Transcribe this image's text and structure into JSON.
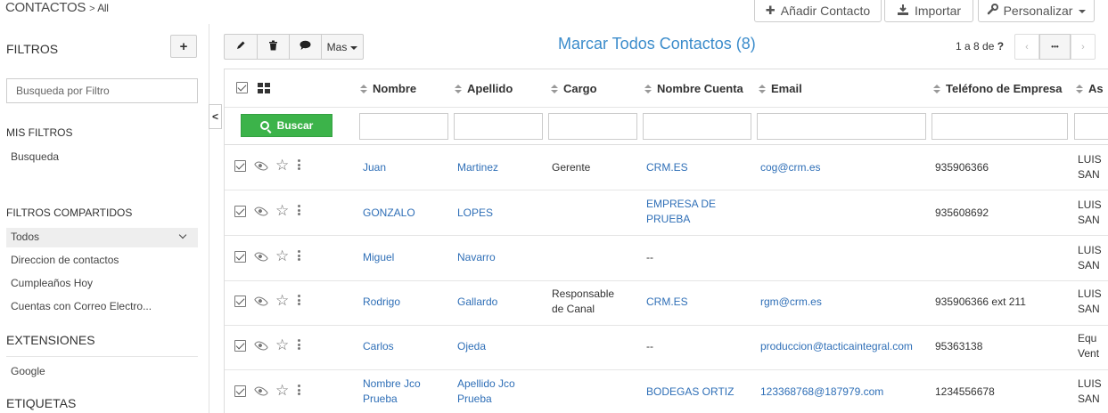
{
  "header": {
    "module_title": "CONTACTOS",
    "breadcrumb_sep": ">",
    "breadcrumb_current": "All",
    "add_label": "Añadir Contacto",
    "import_label": "Importar",
    "personalize_label": "Personalizar"
  },
  "sidebar": {
    "filters_heading": "FILTROS",
    "add_filter_symbol": "+",
    "search_placeholder": "Busqueda por Filtro",
    "my_filters_heading": "MIS FILTROS",
    "my_filters": [
      "Busqueda"
    ],
    "shared_filters_heading": "FILTROS COMPARTIDOS",
    "shared_filters": [
      "Todos",
      "Direccion de contactos",
      "Cumpleaños Hoy",
      "Cuentas con Correo Electro..."
    ],
    "extensions_heading": "EXTENSIONES",
    "extensions": [
      "Google"
    ],
    "tags_heading": "ETIQUETAS",
    "collapse_symbol": "<"
  },
  "actions": {
    "more_label": "Mas",
    "mark_all_label": "Marcar Todos Contactos (8)",
    "pager_range": "1 a 8",
    "pager_of": "de",
    "pager_total": "?",
    "pager_more": "•••",
    "pager_prev": "‹",
    "pager_next": "›"
  },
  "table": {
    "columns": [
      "Nombre",
      "Apellido",
      "Cargo",
      "Nombre Cuenta",
      "Email",
      "Teléfono de Empresa",
      "As"
    ],
    "search_button": "Buscar",
    "rows": [
      {
        "nombre": "Juan",
        "apellido": "Martinez",
        "cargo": "Gerente",
        "cuenta": "CRM.ES",
        "email": "cog@crm.es",
        "telefono": "935906366",
        "asignado": "LUIS SAN"
      },
      {
        "nombre": "GONZALO",
        "apellido": "LOPES",
        "cargo": "",
        "cuenta": "EMPRESA DE PRUEBA",
        "email": "",
        "telefono": "935608692",
        "asignado": "LUIS SAN"
      },
      {
        "nombre": "Miguel",
        "apellido": "Navarro",
        "cargo": "",
        "cuenta": "--",
        "email": "",
        "telefono": "",
        "asignado": "LUIS SAN"
      },
      {
        "nombre": "Rodrigo",
        "apellido": "Gallardo",
        "cargo": "Responsable de Canal",
        "cuenta": "CRM.ES",
        "email": "rgm@crm.es",
        "telefono": "935906366 ext 211",
        "asignado": "LUIS SAN"
      },
      {
        "nombre": "Carlos",
        "apellido": "Ojeda",
        "cargo": "",
        "cuenta": "--",
        "email": "produccion@tacticaintegral.com",
        "telefono": "95363138",
        "asignado": "Equ Vent"
      },
      {
        "nombre": "Nombre Jco Prueba",
        "apellido": "Apellido Jco Prueba",
        "cargo": "",
        "cuenta": "BODEGAS ORTIZ",
        "email": "123368768@187979.com",
        "telefono": "1234556678",
        "asignado": "LUIS SAN"
      }
    ]
  }
}
